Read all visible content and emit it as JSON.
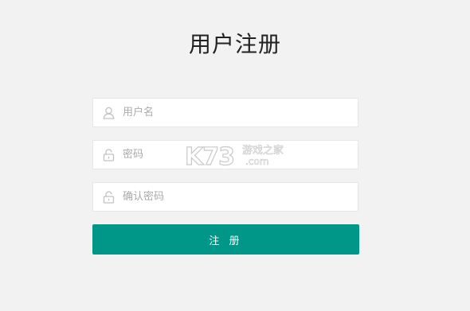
{
  "page": {
    "title": "用户注册"
  },
  "form": {
    "username": {
      "placeholder": "用户名",
      "value": "",
      "icon": "user-icon"
    },
    "password": {
      "placeholder": "密码",
      "value": "",
      "icon": "lock-icon"
    },
    "confirm_password": {
      "placeholder": "确认密码",
      "value": "",
      "icon": "lock-icon"
    },
    "submit_label": "注 册"
  },
  "watermark": {
    "logo_text": "K73",
    "tagline": "游戏之家",
    "domain": ".com"
  },
  "colors": {
    "accent": "#009688",
    "background": "#f2f2f2",
    "field_bg": "#ffffff",
    "icon": "#c2c2c2"
  }
}
